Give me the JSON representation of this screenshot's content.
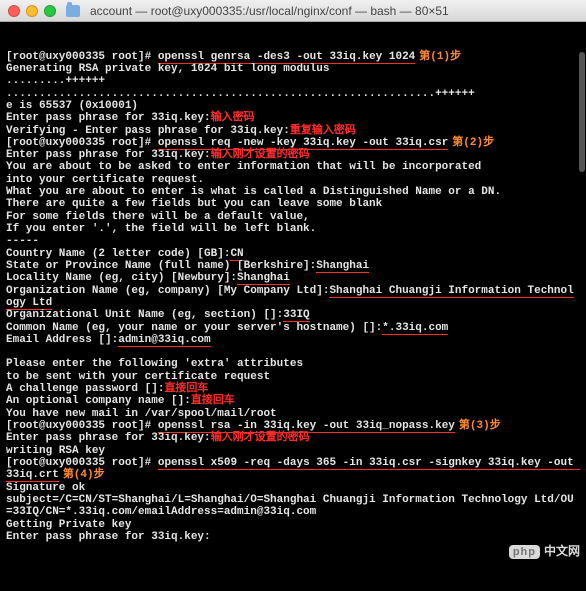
{
  "window": {
    "title": "account — root@uxy000335:/usr/local/nginx/conf — bash — 80×51"
  },
  "prompt": "[root@uxy000335 root]#",
  "steps": {
    "s1": "第(1)步",
    "s2": "第(2)步",
    "s3": "第(3)步",
    "s4": "第(4)步"
  },
  "cmds": {
    "c1": "openssl genrsa -des3 -out 33iq.key 1024",
    "c2": "openssl req -new -key 33iq.key -out 33iq.csr",
    "c3": "openssl rsa -in 33iq.key -out 33iq_nopass.key",
    "c4": "openssl x509 -req -days 365 -in 33iq.csr -signkey 33iq.key -out 33iq.crt"
  },
  "ann": {
    "enterpw": "输入密码",
    "reenterpw": "重复输入密码",
    "enterprevpw": "输入刚才设置的密码",
    "enterprevpw2": "输入刚才设置的密码",
    "enter": "直接回车"
  },
  "out": {
    "gen1": "Generating RSA private key, 1024 bit long modulus",
    "dots1": ".........++++++",
    "dots2": ".................................................................++++++",
    "eis": "e is 65537 (0x10001)",
    "enterpp": "Enter pass phrase for 33iq.key:",
    "verifypp": "Verifying - Enter pass phrase for 33iq.key:",
    "about1": "You are about to be asked to enter information that will be incorporated",
    "about2": "into your certificate request.",
    "about3": "What you are about to enter is what is called a Distinguished Name or a DN.",
    "about4": "There are quite a few fields but you can leave some blank",
    "about5": "For some fields there will be a default value,",
    "about6": "If you enter '.', the field will be left blank.",
    "dash": "-----",
    "cn_prompt": "Country Name (2 letter code) [GB]:",
    "cn_val": "CN",
    "st_prompt": "State or Province Name (full name) [Berkshire]:",
    "st_val": "Shanghai",
    "loc_prompt": "Locality Name (eg, city) [Newbury]:",
    "loc_val": "Shanghai",
    "org_prompt": "Organization Name (eg, company) [My Company Ltd]:",
    "org_val": "Shanghai Chuangji Information Technology Ltd",
    "ou_prompt": "Organizational Unit Name (eg, section) []:",
    "ou_val": "33IQ",
    "cnm_prompt": "Common Name (eg, your name or your server's hostname) []:",
    "cnm_val": "*.33iq.com",
    "em_prompt": "Email Address []:",
    "em_val": "admin@33iq.com",
    "extra1": "Please enter the following 'extra' attributes",
    "extra2": "to be sent with your certificate request",
    "chpw": "A challenge password []:",
    "ocn": "An optional company name []:",
    "mail": "You have new mail in /var/spool/mail/root",
    "wrsa": "writing RSA key",
    "sigok": "Signature ok",
    "subject": "subject=/C=CN/ST=Shanghai/L=Shanghai/O=Shanghai Chuangji Information Technology Ltd/OU=33IQ/CN=*.33iq.com/emailAddress=admin@33iq.com",
    "getpk": "Getting Private key"
  },
  "watermark": {
    "logo": "php",
    "text": "中文网"
  }
}
